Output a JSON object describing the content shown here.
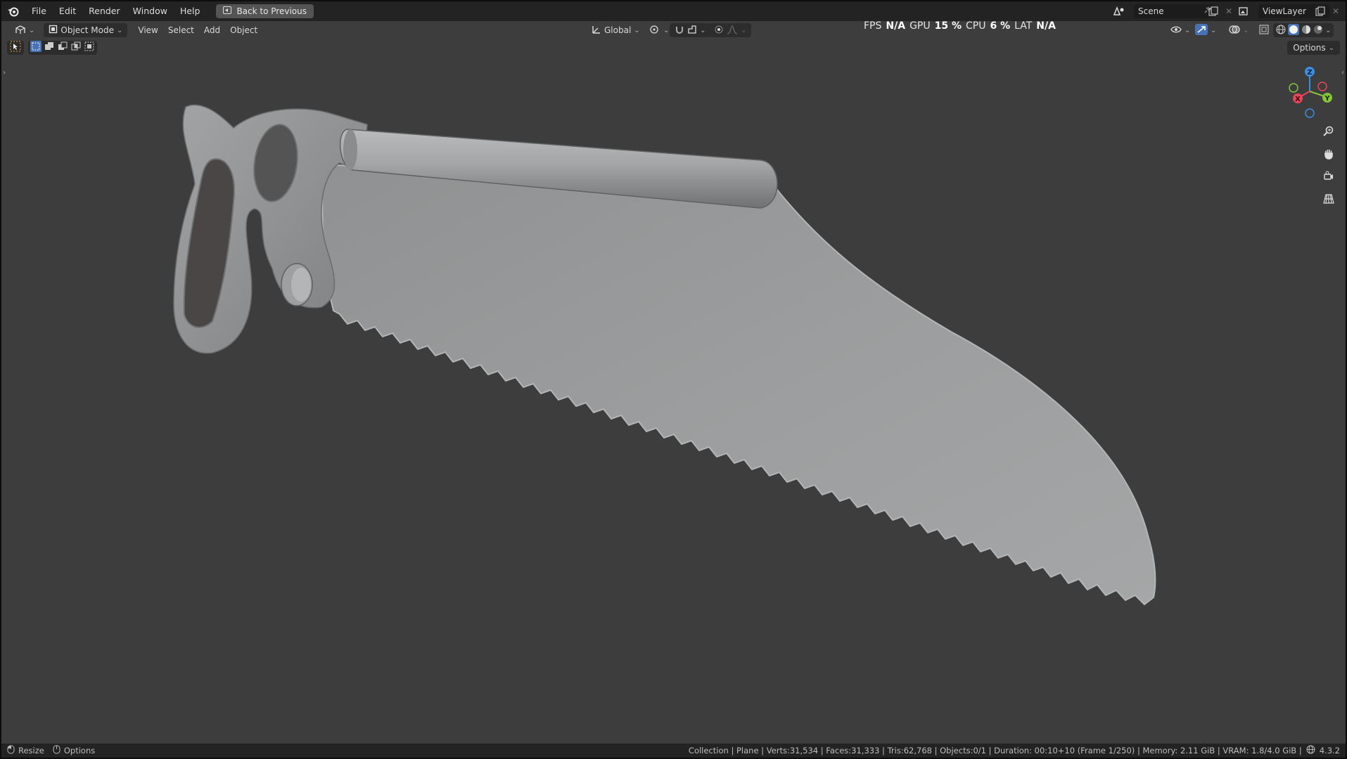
{
  "menu": {
    "items": [
      "File",
      "Edit",
      "Render",
      "Window",
      "Help"
    ],
    "back_button": "Back to Previous"
  },
  "scene_selector": {
    "value": "Scene"
  },
  "viewlayer_selector": {
    "value": "ViewLayer"
  },
  "header": {
    "mode": "Object Mode",
    "menus": [
      "View",
      "Select",
      "Add",
      "Object"
    ],
    "transform_orientation": "Global",
    "options_label": "Options"
  },
  "perf": {
    "fps_label": "FPS",
    "fps_value": "N/A",
    "gpu_label": "GPU",
    "gpu_value": "15 %",
    "cpu_label": "CPU",
    "cpu_value": "6 %",
    "lat_label": "LAT",
    "lat_value": "N/A"
  },
  "gizmo": {
    "z": "Z",
    "y": "Y",
    "x": "X"
  },
  "status": {
    "left_1": "Resize",
    "left_2": "Options",
    "right": "Collection | Plane | Verts:31,534 | Faces:31,333 | Tris:62,768 | Objects:0/1 | Duration: 00:10+10 (Frame 1/250) | Memory: 2.11 GiB | VRAM: 1.8/4.0 GiB |",
    "version": "4.3.2"
  },
  "colors": {
    "viewport_bg": "#3d3d3d",
    "model_gray": "#9a9c9d",
    "axis_x": "#e8475a",
    "axis_y": "#86c53b",
    "axis_z": "#3c8fe0"
  }
}
